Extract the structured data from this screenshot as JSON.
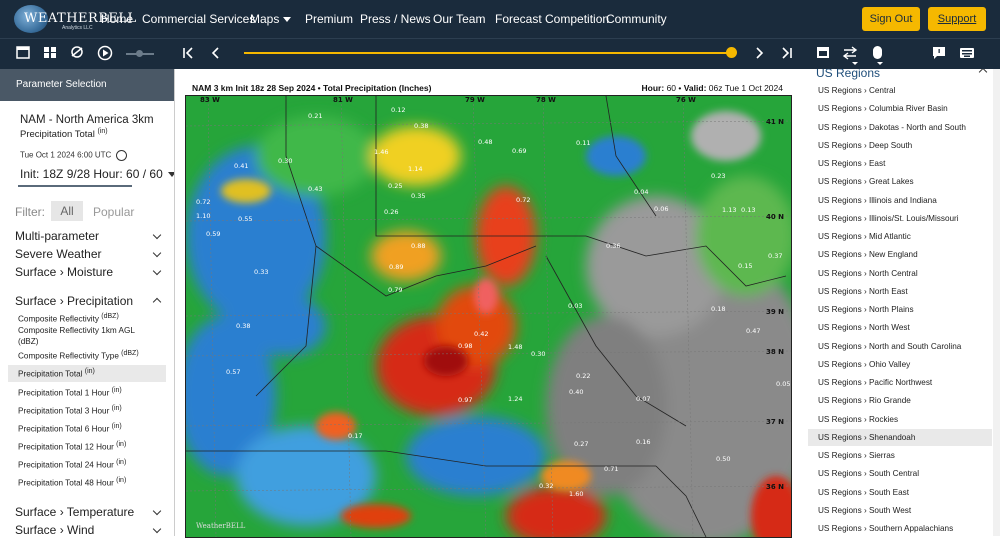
{
  "nav": {
    "logo_text": "WEATHERBELL",
    "logo_sub": "Analytics LLC",
    "links": [
      "Home",
      "Commercial Services",
      "Maps",
      "Premium",
      "Press / News",
      "Our Team",
      "Forecast Competition",
      "Community"
    ],
    "sign_out": "Sign Out",
    "support": "Support"
  },
  "toolbar": {
    "icons": [
      "layout-single-icon",
      "layout-grid-icon",
      "no-sync-icon",
      "play-icon",
      "first-frame-icon",
      "prev-frame-icon",
      "next-frame-icon",
      "last-frame-icon",
      "calendar-icon",
      "compare-icon",
      "mouse-icon",
      "comment-icon",
      "keyboard-icon"
    ],
    "accent": "#f5b800",
    "progress": 1.0
  },
  "left_panel": {
    "header": "Parameter Selection",
    "model": "NAM - North America 3km",
    "parameter": "Precipitation Total",
    "parameter_unit": "(in)",
    "valid_date": "Tue Oct 1 2024 6:00 UTC",
    "init_hour": "Init: 18Z 9/28   Hour: 60 / 60",
    "filter_label": "Filter:",
    "filter_all": "All",
    "filter_popular": "Popular",
    "categories_top": [
      "Multi-parameter",
      "Severe Weather",
      "Surface › Moisture"
    ],
    "precip_category": "Surface › Precipitation",
    "precip_items": [
      {
        "label": "Composite Reflectivity",
        "unit": "(dBZ)"
      },
      {
        "label": "Composite Reflectivity 1km AGL",
        "unit": ""
      },
      {
        "label": "(dBZ)",
        "unit": ""
      },
      {
        "label": "Composite Reflectivity Type",
        "unit": "(dBZ)"
      },
      {
        "label": "Precipitation Total",
        "unit": "(in)"
      },
      {
        "label": "Precipitation Total 1 Hour",
        "unit": "(in)"
      },
      {
        "label": "Precipitation Total 3 Hour",
        "unit": "(in)"
      },
      {
        "label": "Precipitation Total 6 Hour",
        "unit": "(in)"
      },
      {
        "label": "Precipitation Total 12 Hour",
        "unit": "(in)"
      },
      {
        "label": "Precipitation Total 24 Hour",
        "unit": "(in)"
      },
      {
        "label": "Precipitation Total 48 Hour",
        "unit": "(in)"
      }
    ],
    "categories_bottom": [
      "Surface › Temperature",
      "Surface › Wind"
    ]
  },
  "map": {
    "title_left": "NAM 3 km Init 18z 28 Sep 2024 • Total Precipitation (Inches)",
    "hour_label": "Hour:",
    "hour_value": "60",
    "valid_label": "Valid:",
    "valid_value": "06z Tue 1 Oct 2024",
    "lon_labels": [
      "83 W",
      "81 W",
      "79 W",
      "78 W",
      "76 W"
    ],
    "lat_labels": [
      "41 N",
      "40 N",
      "39 N",
      "38 N",
      "37 N",
      "36 N"
    ],
    "values": [
      "0.12",
      "0.38",
      "0.21",
      "1.46",
      "1.14",
      "0.30",
      "0.41",
      "0.43",
      "0.72",
      "1.10",
      "0.59",
      "0.55",
      "0.33",
      "0.89",
      "0.88",
      "0.36",
      "0.48",
      "0.69",
      "0.72",
      "0.25",
      "0.26",
      "0.35",
      "0.38",
      "0.42",
      "0.97",
      "1.48",
      "0.79",
      "0.22",
      "0.27",
      "0.16",
      "0.03",
      "0.18",
      "0.06",
      "0.32",
      "0.71",
      "1.60",
      "1.24",
      "0.98",
      "1.13",
      "0.04",
      "0.30",
      "0.50",
      "0.40",
      "0.11",
      "0.23",
      "0.15",
      "0.37",
      "0.07",
      "0.13",
      "0.47",
      "0.57",
      "0.17",
      "0.05"
    ],
    "watermark": "WeatherBELL"
  },
  "right_panel": {
    "title": "US Regions",
    "regions": [
      "US Regions › Central",
      "US Regions › Columbia River Basin",
      "US Regions › Dakotas - North and South",
      "US Regions › Deep South",
      "US Regions › East",
      "US Regions › Great Lakes",
      "US Regions › Illinois and Indiana",
      "US Regions › Illinois/St. Louis/Missouri",
      "US Regions › Mid Atlantic",
      "US Regions › New England",
      "US Regions › North Central",
      "US Regions › North East",
      "US Regions › North Plains",
      "US Regions › North West",
      "US Regions › North and South Carolina",
      "US Regions › Ohio Valley",
      "US Regions › Pacific Northwest",
      "US Regions › Rio Grande",
      "US Regions › Rockies",
      "US Regions › Shenandoah",
      "US Regions › Sierras",
      "US Regions › South Central",
      "US Regions › South East",
      "US Regions › South West",
      "US Regions › Southern Appalachians"
    ],
    "selected_index": 19
  }
}
